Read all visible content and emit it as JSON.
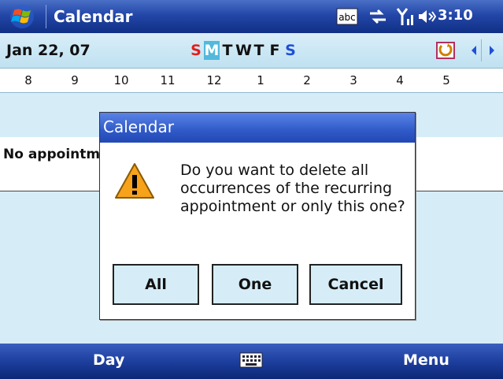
{
  "titlebar": {
    "title": "Calendar",
    "time": "3:10",
    "icons": [
      "windows-start-icon",
      "abc-input-icon",
      "connectivity-icon",
      "signal-icon",
      "volume-icon"
    ]
  },
  "datebar": {
    "date": "Jan 22, 07",
    "weekdays": [
      "S",
      "M",
      "T",
      "W",
      "T",
      "F",
      "S"
    ],
    "selected_index": 1
  },
  "hours": [
    "8",
    "9",
    "10",
    "11",
    "12",
    "1",
    "2",
    "3",
    "4",
    "5"
  ],
  "content": {
    "no_appointments": "No appointments"
  },
  "dialog": {
    "title": "Calendar",
    "message": "Do you want to delete all occurrences of the recurring appointment or only this one?",
    "buttons": {
      "all": "All",
      "one": "One",
      "cancel": "Cancel"
    }
  },
  "softkeys": {
    "left": "Day",
    "right": "Menu"
  },
  "colors": {
    "sunday": "#e02020",
    "saturday": "#1f4fd8",
    "selected_day": "#52b9dc"
  }
}
